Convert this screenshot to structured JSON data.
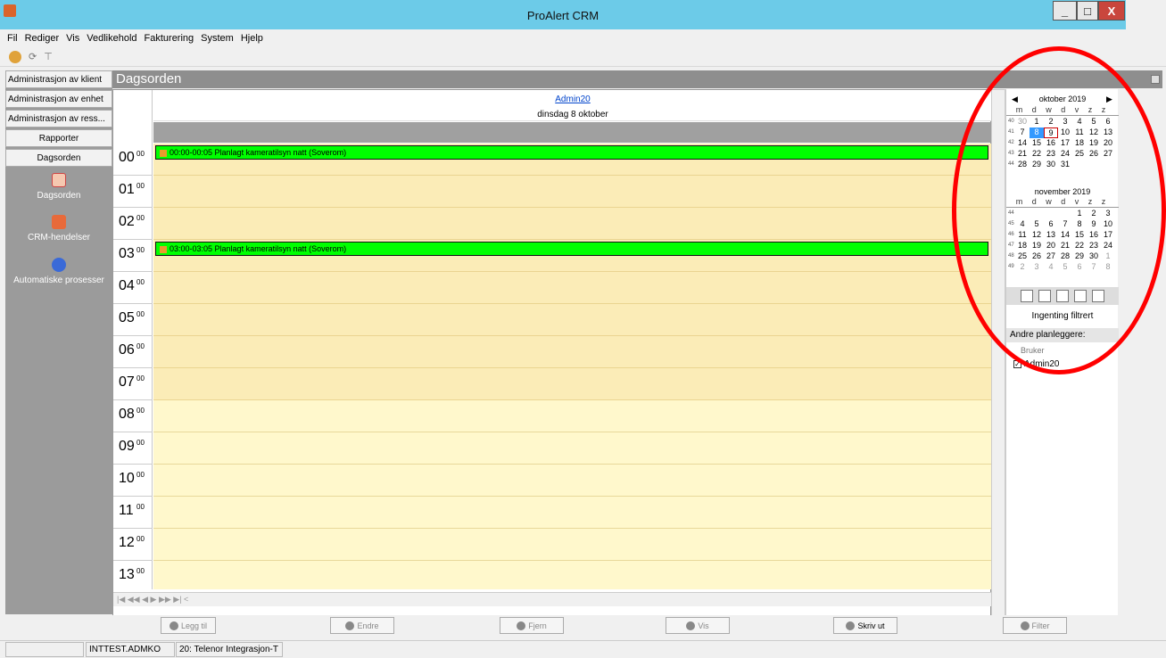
{
  "window": {
    "title": "ProAlert CRM",
    "minimize_label": "_",
    "maximize_label": "□",
    "close_label": "X"
  },
  "menu": [
    "Fil",
    "Rediger",
    "Vis",
    "Vedlikehold",
    "Fakturering",
    "System",
    "Hjelp"
  ],
  "nav": {
    "buttons": [
      "Administrasjon av klient",
      "Administrasjon av enhet",
      "Administrasjon av ress...",
      "Rapporter",
      "Dagsorden"
    ],
    "items": [
      {
        "label": "Dagsorden",
        "icon": "calendar-icon"
      },
      {
        "label": "CRM-hendelser",
        "icon": "event-icon"
      },
      {
        "label": "Automatiske prosesser",
        "icon": "process-icon"
      }
    ]
  },
  "header": {
    "title": "Dagsorden"
  },
  "calendar": {
    "user": "Admin20",
    "date": "dinsdag 8 oktober",
    "hours": [
      "00",
      "01",
      "02",
      "03",
      "04",
      "05",
      "06",
      "07",
      "08",
      "09",
      "10",
      "11",
      "12",
      "13"
    ],
    "minutes": "00",
    "events": [
      {
        "hour": 0,
        "text": "00:00-00:05 Planlagt kameratilsyn natt (Soverom)"
      },
      {
        "hour": 3,
        "text": "03:00-03:05 Planlagt kameratilsyn natt (Soverom)"
      }
    ],
    "nav_buttons": "|◀ ◀◀ ◀ ▶ ▶▶ ▶|  <"
  },
  "mini": {
    "months": [
      {
        "title": "oktober 2019",
        "dow": "m d w d v z z",
        "weeks": [
          {
            "wk": "40",
            "days": [
              "30",
              "1",
              "2",
              "3",
              "4",
              "5",
              "6"
            ]
          },
          {
            "wk": "41",
            "days": [
              "7",
              "8",
              "9",
              "10",
              "11",
              "12",
              "13"
            ]
          },
          {
            "wk": "42",
            "days": [
              "14",
              "15",
              "16",
              "17",
              "18",
              "19",
              "20"
            ]
          },
          {
            "wk": "43",
            "days": [
              "21",
              "22",
              "23",
              "24",
              "25",
              "26",
              "27"
            ]
          },
          {
            "wk": "44",
            "days": [
              "28",
              "29",
              "30",
              "31",
              "",
              "",
              ""
            ]
          }
        ]
      },
      {
        "title": "november 2019",
        "dow": "m d w d v z z",
        "weeks": [
          {
            "wk": "44",
            "days": [
              "",
              "",
              "",
              "",
              "1",
              "2",
              "3"
            ]
          },
          {
            "wk": "45",
            "days": [
              "4",
              "5",
              "6",
              "7",
              "8",
              "9",
              "10"
            ]
          },
          {
            "wk": "46",
            "days": [
              "11",
              "12",
              "13",
              "14",
              "15",
              "16",
              "17"
            ]
          },
          {
            "wk": "47",
            "days": [
              "18",
              "19",
              "20",
              "21",
              "22",
              "23",
              "24"
            ]
          },
          {
            "wk": "48",
            "days": [
              "25",
              "26",
              "27",
              "28",
              "29",
              "30",
              "1"
            ]
          },
          {
            "wk": "49",
            "days": [
              "2",
              "3",
              "4",
              "5",
              "6",
              "7",
              "8"
            ]
          }
        ]
      }
    ],
    "selected_day": "8",
    "today": "9",
    "filter": "Ingenting filtrert",
    "other_planners": "Andre planleggere:",
    "column": "Bruker",
    "user_checked": "Admin20"
  },
  "bottom_buttons": [
    "Legg til",
    "Endre",
    "Fjern",
    "Vis",
    "Skriv ut",
    "Filter"
  ],
  "status": {
    "user": "INTTEST.ADMKO",
    "org": "20: Telenor Integrasjon-T"
  },
  "colors": {
    "accent_titlebar": "#6ccbe8",
    "event": "#00ff00",
    "grid": "#fff8cc",
    "highlight": "#ff0000"
  }
}
